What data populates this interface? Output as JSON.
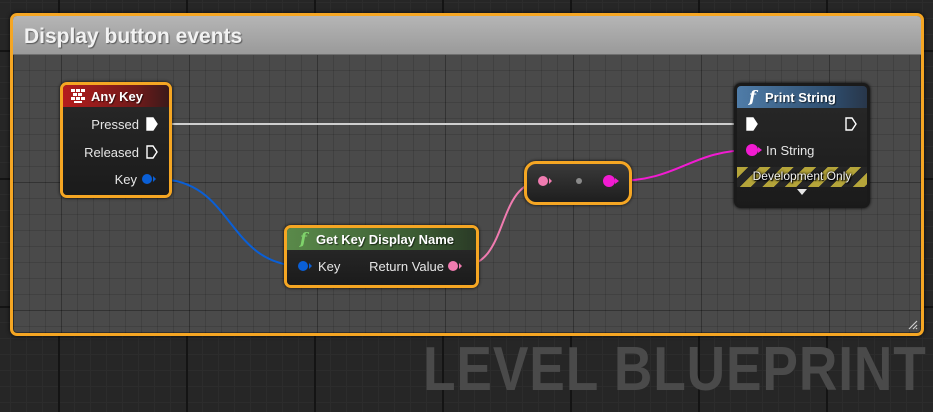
{
  "comment": {
    "title": "Display button events"
  },
  "nodes": {
    "any_key": {
      "title": "Any Key",
      "icon": "keyboard-icon",
      "pins": {
        "pressed": "Pressed",
        "released": "Released",
        "key": "Key"
      }
    },
    "get_key_display_name": {
      "title": "Get Key Display Name",
      "icon": "function-icon",
      "pins": {
        "key": "Key",
        "return_value": "Return Value"
      }
    },
    "print_string": {
      "title": "Print String",
      "icon": "function-icon",
      "pins": {
        "in_string": "In String"
      },
      "development_only": "Development Only",
      "expand_icon": "chevron-down-icon"
    },
    "reroute": {
      "icon": "reroute-dot-icon"
    }
  },
  "watermark": "LEVEL BLUEPRINT",
  "colors": {
    "selection_border": "#f5a623",
    "exec_wire": "#c8c8c8",
    "struct_pin": "#0a5fd6",
    "text_pin": "#f07bb0",
    "string_pin": "#f21bd2",
    "event_header": "#b51d1d",
    "pure_function_header": "#5a8a4a",
    "function_header": "#4f7ca8",
    "function_icon": "#7fd36b"
  }
}
